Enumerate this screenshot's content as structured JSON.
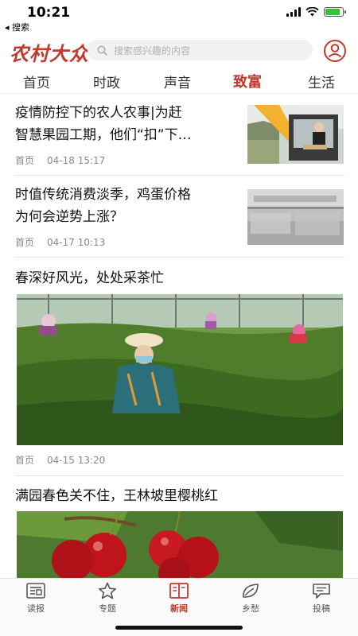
{
  "status_bar": {
    "time": "10:21",
    "back_label": "◂ 搜索"
  },
  "header": {
    "logo": "农村大众",
    "search_placeholder": "搜索感兴趣的内容"
  },
  "tabs": [
    {
      "label": "首页",
      "active": false
    },
    {
      "label": "时政",
      "active": false
    },
    {
      "label": "声音",
      "active": false
    },
    {
      "label": "致富",
      "active": true
    },
    {
      "label": "生活",
      "active": false
    }
  ],
  "articles": [
    {
      "title_line1": "疫情防控下的农人农事|为赶",
      "title_line2": "智慧果园工期，他们“扣”下…",
      "source": "首页",
      "time": "04-18 15:17"
    },
    {
      "title_line1": "时值传统消费淡季，鸡蛋价格",
      "title_line2": "为何会逆势上涨？",
      "source": "首页",
      "time": "04-17 10:13"
    },
    {
      "title": "春深好风光，处处采茶忙",
      "source": "首页",
      "time": "04-15 13:20"
    },
    {
      "title": "满园春色关不住，王林坡里樱桃红"
    }
  ],
  "bottom_nav": [
    {
      "label": "读报",
      "icon": "newspaper-icon",
      "active": false
    },
    {
      "label": "专题",
      "icon": "star-icon",
      "active": false
    },
    {
      "label": "新闻",
      "icon": "book-icon",
      "active": true
    },
    {
      "label": "乡愁",
      "icon": "leaf-icon",
      "active": false
    },
    {
      "label": "投稿",
      "icon": "message-icon",
      "active": false
    }
  ],
  "colors": {
    "accent": "#c0392b",
    "battery": "#36c136"
  }
}
